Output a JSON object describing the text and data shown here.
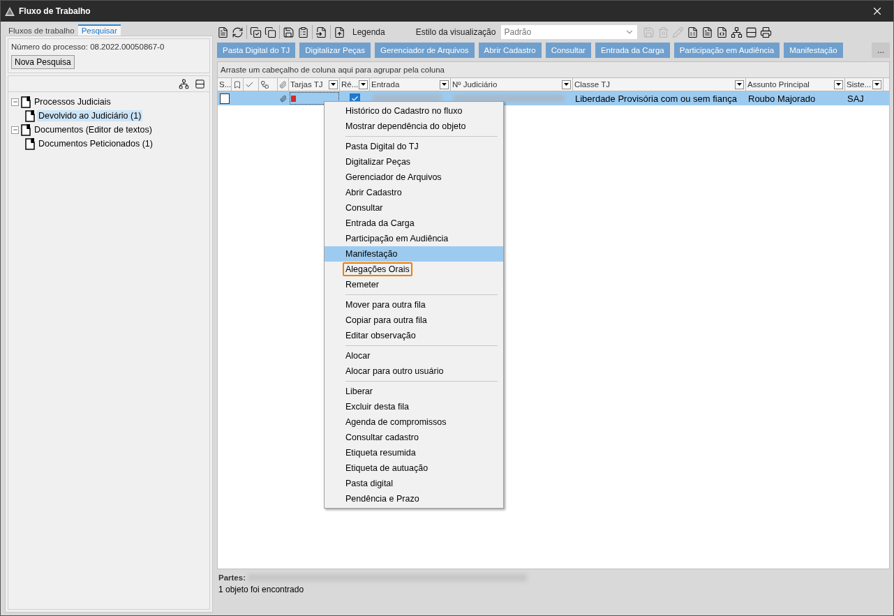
{
  "window": {
    "title": "Fluxo de Trabalho"
  },
  "left_tabs": [
    {
      "label": "Fluxos de trabalho",
      "selected": false
    },
    {
      "label": "Pesquisar",
      "selected": true
    }
  ],
  "search_info": {
    "label": "Número do processo: 08.2022.00050867-0",
    "button": "Nova Pesquisa"
  },
  "tree": [
    {
      "label": "Processos Judiciais",
      "expanded": true,
      "selected": false,
      "children": [
        {
          "label": "Devolvido ao Judiciário (1)",
          "selected": true
        }
      ]
    },
    {
      "label": "Documentos (Editor de textos)",
      "expanded": true,
      "selected": false,
      "children": [
        {
          "label": "Documentos Peticionados (1)",
          "selected": false
        }
      ]
    }
  ],
  "toolbar": {
    "legend_label": "Legenda",
    "view_style_label": "Estilo da visualização",
    "view_style_placeholder": "Padrão",
    "icons": [
      {
        "disabled": false
      },
      {
        "disabled": false
      },
      {
        "disabled": false
      },
      {
        "disabled": false
      },
      {
        "disabled": false
      },
      {
        "disabled": false
      },
      {
        "disabled": false
      },
      {
        "disabled": false
      }
    ],
    "right_icons": [
      {
        "disabled": true
      },
      {
        "disabled": true
      },
      {
        "disabled": true
      },
      {
        "disabled": false
      },
      {
        "disabled": false
      },
      {
        "disabled": false
      },
      {
        "disabled": false
      },
      {
        "disabled": false
      },
      {
        "disabled": false
      }
    ]
  },
  "action_buttons": [
    "Pasta Digital do TJ",
    "Digitalizar Peças",
    "Gerenciador de Arquivos",
    "Abrir Cadastro",
    "Consultar",
    "Entrada da Carga",
    "Participação em Audiência",
    "Manifestação"
  ],
  "more_button": "...",
  "group_hint": "Arraste um cabeçalho de coluna aqui para agrupar pela coluna",
  "columns": [
    {
      "kind": "text",
      "label": "S..."
    },
    {
      "kind": "icon"
    },
    {
      "kind": "icon"
    },
    {
      "kind": "icon"
    },
    {
      "kind": "icon"
    },
    {
      "kind": "filter",
      "label": "Tarjas TJ"
    },
    {
      "kind": "filter",
      "label": "Ré..."
    },
    {
      "kind": "filter",
      "label": "Entrada"
    },
    {
      "kind": "filter",
      "label": "Nº Judiciário"
    },
    {
      "kind": "filter",
      "label": "Classe TJ"
    },
    {
      "kind": "filter",
      "label": "Assunto Principal"
    },
    {
      "kind": "filter",
      "label": "Siste..."
    }
  ],
  "rows": [
    {
      "selected": true,
      "checked": false,
      "attachment": true,
      "color": "#d62828",
      "reu_preso": true,
      "classe": "Liberdade Provisória com ou sem fiança",
      "assunto": "Roubo Majorado",
      "sistema": "SAJ"
    }
  ],
  "context_menu": [
    [
      {
        "label": "Histórico do Cadastro no fluxo",
        "selected": false,
        "outlined": false
      },
      {
        "label": "Mostrar dependência do objeto",
        "selected": false,
        "outlined": false
      }
    ],
    [
      {
        "label": "Pasta Digital do TJ",
        "selected": false,
        "outlined": false
      },
      {
        "label": "Digitalizar Peças",
        "selected": false,
        "outlined": false
      },
      {
        "label": "Gerenciador de Arquivos",
        "selected": false,
        "outlined": false
      },
      {
        "label": "Abrir Cadastro",
        "selected": false,
        "outlined": false
      },
      {
        "label": "Consultar",
        "selected": false,
        "outlined": false
      },
      {
        "label": "Entrada da Carga",
        "selected": false,
        "outlined": false
      },
      {
        "label": "Participação em Audiência",
        "selected": false,
        "outlined": false
      },
      {
        "label": "Manifestação",
        "selected": true,
        "outlined": false
      },
      {
        "label": "Alegações Orais",
        "selected": false,
        "outlined": true
      },
      {
        "label": "Remeter",
        "selected": false,
        "outlined": false
      }
    ],
    [
      {
        "label": "Mover para outra fila",
        "selected": false,
        "outlined": false
      },
      {
        "label": "Copiar para outra fila",
        "selected": false,
        "outlined": false
      },
      {
        "label": "Editar observação",
        "selected": false,
        "outlined": false
      }
    ],
    [
      {
        "label": "Alocar",
        "selected": false,
        "outlined": false
      },
      {
        "label": "Alocar para outro usuário",
        "selected": false,
        "outlined": false
      }
    ],
    [
      {
        "label": "Liberar",
        "selected": false,
        "outlined": false
      },
      {
        "label": "Excluir desta fila",
        "selected": false,
        "outlined": false
      },
      {
        "label": "Agenda de compromissos",
        "selected": false,
        "outlined": false
      },
      {
        "label": "Consultar cadastro",
        "selected": false,
        "outlined": false
      },
      {
        "label": "Etiqueta resumida",
        "selected": false,
        "outlined": false
      },
      {
        "label": "Etiqueta de autuação",
        "selected": false,
        "outlined": false
      },
      {
        "label": "Pasta digital",
        "selected": false,
        "outlined": false
      },
      {
        "label": "Pendência e Prazo",
        "selected": false,
        "outlined": false
      }
    ]
  ],
  "footer": {
    "parties_label": "Partes:",
    "status": "1 objeto foi encontrado"
  }
}
